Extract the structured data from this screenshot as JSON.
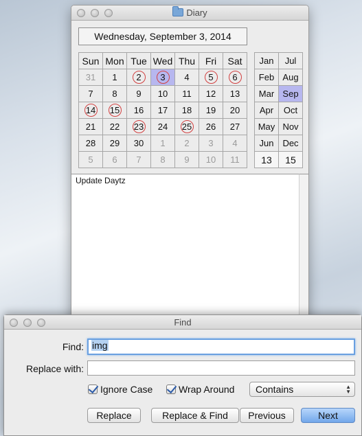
{
  "diary": {
    "title": "Diary",
    "date_header": "Wednesday, September 3, 2014",
    "weekdays": [
      "Sun",
      "Mon",
      "Tue",
      "Wed",
      "Thu",
      "Fri",
      "Sat"
    ],
    "weeks": [
      [
        {
          "d": "31",
          "dim": true
        },
        {
          "d": "1"
        },
        {
          "d": "2",
          "mark": true
        },
        {
          "d": "3",
          "mark": true,
          "sel": true
        },
        {
          "d": "4"
        },
        {
          "d": "5",
          "mark": true
        },
        {
          "d": "6",
          "mark": true
        }
      ],
      [
        {
          "d": "7"
        },
        {
          "d": "8"
        },
        {
          "d": "9"
        },
        {
          "d": "10"
        },
        {
          "d": "11"
        },
        {
          "d": "12"
        },
        {
          "d": "13"
        }
      ],
      [
        {
          "d": "14",
          "mark": true
        },
        {
          "d": "15",
          "mark": true
        },
        {
          "d": "16"
        },
        {
          "d": "17"
        },
        {
          "d": "18"
        },
        {
          "d": "19"
        },
        {
          "d": "20"
        }
      ],
      [
        {
          "d": "21"
        },
        {
          "d": "22"
        },
        {
          "d": "23",
          "mark": true
        },
        {
          "d": "24"
        },
        {
          "d": "25",
          "mark": true
        },
        {
          "d": "26"
        },
        {
          "d": "27"
        }
      ],
      [
        {
          "d": "28"
        },
        {
          "d": "29"
        },
        {
          "d": "30"
        },
        {
          "d": "1",
          "dim": true
        },
        {
          "d": "2",
          "dim": true
        },
        {
          "d": "3",
          "dim": true
        },
        {
          "d": "4",
          "dim": true
        }
      ],
      [
        {
          "d": "5",
          "dim": true
        },
        {
          "d": "6",
          "dim": true
        },
        {
          "d": "7",
          "dim": true
        },
        {
          "d": "8",
          "dim": true
        },
        {
          "d": "9",
          "dim": true
        },
        {
          "d": "10",
          "dim": true
        },
        {
          "d": "11",
          "dim": true
        }
      ]
    ],
    "months": [
      [
        "Jan",
        "Jul"
      ],
      [
        "Feb",
        "Aug"
      ],
      [
        "Mar",
        "Sep"
      ],
      [
        "Apr",
        "Oct"
      ],
      [
        "May",
        "Nov"
      ],
      [
        "Jun",
        "Dec"
      ]
    ],
    "selected_month": "Sep",
    "year_left": "13",
    "year_right": "15",
    "note_text": "Update Daytz"
  },
  "find": {
    "title": "Find",
    "find_label": "Find:",
    "find_value": "img",
    "replace_label": "Replace with:",
    "replace_value": "",
    "ignore_case_label": "Ignore Case",
    "ignore_case_checked": true,
    "wrap_around_label": "Wrap Around",
    "wrap_around_checked": true,
    "match_mode": "Contains",
    "buttons": {
      "replace": "Replace",
      "replace_find": "Replace & Find",
      "previous": "Previous",
      "next": "Next"
    }
  }
}
